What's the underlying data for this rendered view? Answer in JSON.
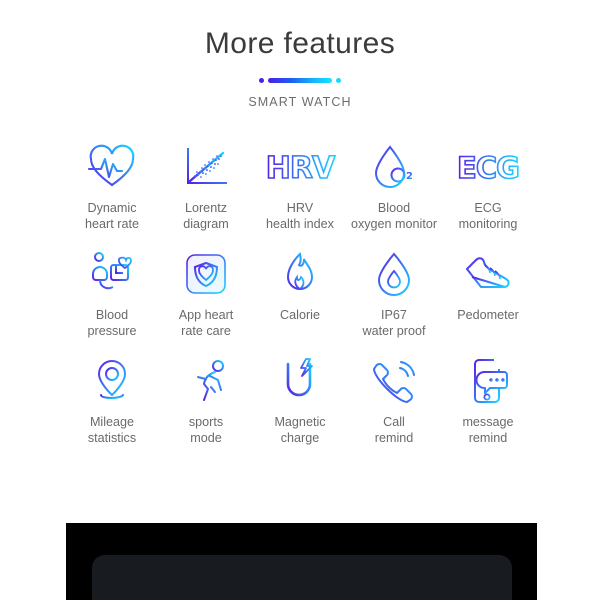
{
  "header": {
    "title": "More features",
    "subtitle": "SMART WATCH",
    "divider": {
      "left_dot_color": "#4b1fe8",
      "right_dot_color": "#17d8ff",
      "bar_gradient_from": "#4b1fe8",
      "bar_gradient_to": "#12e6ff"
    }
  },
  "theme": {
    "background": "#ffffff",
    "title_color": "#3b3b3b",
    "label_color": "#6a6a6a",
    "accent_start": "#4b1fe8",
    "accent_end": "#12e6ff",
    "panel_black": "#000000",
    "panel_screen": "#181c21"
  },
  "features": {
    "rows": [
      [
        {
          "icon": "heart-pulse-icon",
          "label": "Dynamic\nheart rate"
        },
        {
          "icon": "scatter-plot-icon",
          "label": "Lorentz\ndiagram"
        },
        {
          "icon": "hrv-text-icon",
          "label": "HRV\nhealth index",
          "text": "HRV"
        },
        {
          "icon": "blood-oxygen-drop-icon",
          "label": "Blood\noxygen monitor",
          "text": "O"
        },
        {
          "icon": "ecg-text-icon",
          "label": "ECG\nmonitoring",
          "text": "ECG"
        }
      ],
      [
        {
          "icon": "blood-pressure-cuff-icon",
          "label": "Blood\npressure"
        },
        {
          "icon": "app-shield-heart-icon",
          "label": "App heart\nrate care"
        },
        {
          "icon": "flame-icon",
          "label": "Calorie"
        },
        {
          "icon": "water-drop-icon",
          "label": "IP67\nwater proof"
        },
        {
          "icon": "sneaker-icon",
          "label": "Pedometer"
        }
      ],
      [
        {
          "icon": "map-pin-icon",
          "label": "Mileage\nstatistics"
        },
        {
          "icon": "running-person-icon",
          "label": "sports\nmode"
        },
        {
          "icon": "magnet-bolt-icon",
          "label": "Magnetic\ncharge"
        },
        {
          "icon": "phone-ring-icon",
          "label": "Call\nremind"
        },
        {
          "icon": "phone-message-icon",
          "label": "message\nremind"
        }
      ]
    ]
  }
}
